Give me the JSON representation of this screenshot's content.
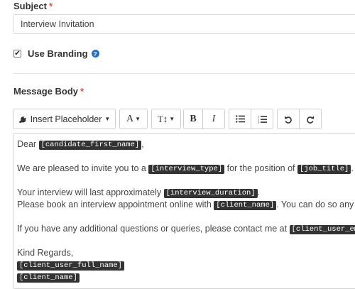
{
  "subject": {
    "label": "Subject",
    "required_mark": "*",
    "value": "Interview Invitation"
  },
  "branding": {
    "checked": true,
    "check_glyph": "✔",
    "label": "Use Branding",
    "help_glyph": "?"
  },
  "message_body": {
    "label": "Message Body",
    "required_mark": "*"
  },
  "toolbar": {
    "insert_placeholder_label": "Insert Placeholder",
    "font_label": "A",
    "text_size_label": "T↕",
    "bold_label": "B",
    "italic_label": "I",
    "icons": [
      "plug-icon",
      "chevron-down-icon",
      "bulleted-list-icon",
      "numbered-list-icon",
      "undo-icon",
      "redo-icon"
    ]
  },
  "editor": {
    "dear": "Dear",
    "candidate_first_name": "[candidate_first_name]",
    "comma": ",",
    "invite_text": "We are pleased to invite you to a",
    "interview_type": "[interview_type]",
    "position_text": "for the position of",
    "job_title": "[job_title]",
    "period": ".",
    "duration_text": "Your interview will last approximately",
    "interview_duration": "[interview_duration]",
    "book_text": "Please book an interview appointment online with",
    "client_name": "[client_name]",
    "book_tail": ". You can do so any tim",
    "questions_text": "If you have any additional questions or queries, please contact me at",
    "client_user_email": "[client_user_emai",
    "regards": "Kind Regards,",
    "client_user_full_name": "[client_user_full_name]",
    "client_name_sig": "[client_name]"
  },
  "colors": {
    "required": "#d9534f",
    "help": "#2a6ebd",
    "tag_bg": "#333333"
  }
}
